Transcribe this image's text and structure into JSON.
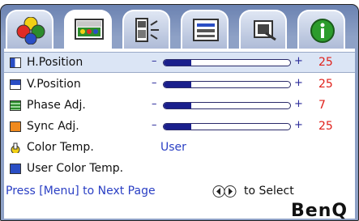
{
  "tabs": [
    {
      "name": "picture-tab",
      "icon": "color-circles-icon",
      "active": false
    },
    {
      "name": "display-tab",
      "icon": "picture-adjust-icon",
      "active": true
    },
    {
      "name": "audio-tab",
      "icon": "speaker-icon",
      "active": false
    },
    {
      "name": "setup-tab",
      "icon": "settings-panel-icon",
      "active": false
    },
    {
      "name": "source-tab",
      "icon": "input-source-icon",
      "active": false
    },
    {
      "name": "info-tab",
      "icon": "info-icon",
      "active": false
    }
  ],
  "menu": {
    "h_position": {
      "label": "H.Position",
      "value": "25",
      "level": 0.22
    },
    "v_position": {
      "label": "V.Position",
      "value": "25",
      "level": 0.22
    },
    "phase_adj": {
      "label": "Phase Adj.",
      "value": "7",
      "level": 0.22
    },
    "sync_adj": {
      "label": "Sync Adj.",
      "value": "25",
      "level": 0.22
    },
    "color_temp": {
      "label": "Color Temp.",
      "value": "User"
    },
    "user_color_temp": {
      "label": "User Color Temp."
    }
  },
  "slider_minus": "–",
  "slider_plus": "+",
  "footer": {
    "hint_next": "Press [Menu] to Next Page",
    "hint_select": "to Select"
  },
  "brand": "BenQ",
  "colors": {
    "accent": "#2a3fc4",
    "value_red": "#e0201a",
    "bar_fill": "#1a1f8c",
    "frame": "#8ea1c6"
  }
}
